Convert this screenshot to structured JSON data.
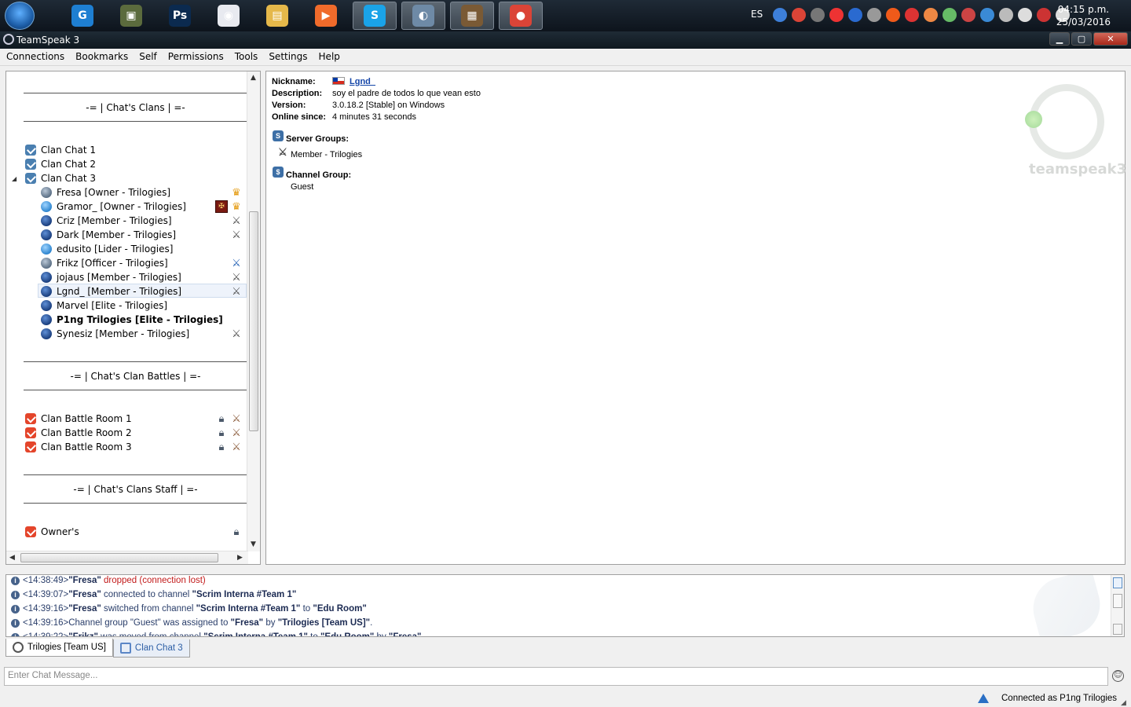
{
  "taskbar": {
    "icons": [
      {
        "name": "teamviewer-like-icon",
        "glyph": "G",
        "color": "#1e7fd2"
      },
      {
        "name": "terminal-icon",
        "glyph": "▣",
        "color": "#5b6b3d"
      },
      {
        "name": "photoshop-icon",
        "glyph": "Ps",
        "color": "#0b2a4f"
      },
      {
        "name": "target-app-icon",
        "glyph": "◉",
        "color": "#e8eaf0"
      },
      {
        "name": "folder-icon",
        "glyph": "▤",
        "color": "#e5b84a"
      },
      {
        "name": "media-player-icon",
        "glyph": "▶",
        "color": "#f06b2b"
      },
      {
        "name": "skype-icon",
        "glyph": "S",
        "color": "#1aa3e8"
      },
      {
        "name": "teamspeak-icon",
        "glyph": "◐",
        "color": "#6e8aa6"
      },
      {
        "name": "minecraft-icon",
        "glyph": "▦",
        "color": "#7a5a35"
      },
      {
        "name": "chrome-icon",
        "glyph": "●",
        "color": "#db4437"
      }
    ],
    "language": "ES",
    "time": "04:15 p.m.",
    "date": "25/03/2016"
  },
  "window": {
    "title": "TeamSpeak 3",
    "min_label": "▁",
    "max_label": "▢",
    "close_label": "✕"
  },
  "menu": [
    "Connections",
    "Bookmarks",
    "Self",
    "Permissions",
    "Tools",
    "Settings",
    "Help"
  ],
  "tree": {
    "spacer_clans": "-= | Chat's Clans | =-",
    "spacer_battles": "-= | Chat's Clan Battles | =-",
    "spacer_staff": "-= | Chat's Clans Staff | =-",
    "channels_top": [
      "Clan Chat 1",
      "Clan Chat 2",
      "Clan Chat 3"
    ],
    "users": [
      {
        "name": "Fresa [Owner - Trilogies]",
        "status": "mute"
      },
      {
        "name": "Gramor_ [Owner - Trilogies]",
        "status": "light"
      },
      {
        "name": "Criz [Member  - Trilogies]",
        "status": "dark"
      },
      {
        "name": "Dark [Member  - Trilogies]",
        "status": "dark"
      },
      {
        "name": "edusito [Lider  - Trilogies]",
        "status": "light"
      },
      {
        "name": "Frikz [Officer  - Trilogies]",
        "status": "mute"
      },
      {
        "name": "jojaus [Member  - Trilogies]",
        "status": "dark"
      },
      {
        "name": "Lgnd_ [Member  - Trilogies]",
        "status": "dark"
      },
      {
        "name": "Marvel [Elite  - Trilogies]",
        "status": "dark"
      },
      {
        "name": "P1ng Trilogies [Elite  - Trilogies]",
        "status": "dark"
      },
      {
        "name": "Synesiz [Member  - Trilogies]",
        "status": "dark"
      }
    ],
    "battle_rooms": [
      "Clan Battle Room 1",
      "Clan Battle Room 2",
      "Clan Battle Room 3"
    ],
    "staff_rooms": [
      "Owner's"
    ]
  },
  "info": {
    "nickname_label": "Nickname:",
    "nickname": "Lgnd_",
    "description_label": "Description:",
    "description": "soy el padre de todos lo que vean esto",
    "version_label": "Version:",
    "version": "3.0.18.2 [Stable] on Windows",
    "online_label": "Online since:",
    "online": "4 minutes 31 seconds",
    "server_groups_label": "Server Groups:",
    "server_group": "Member  - Trilogies",
    "channel_group_label": "Channel Group:",
    "channel_group": "Guest",
    "watermark": "teamspeak3"
  },
  "log": [
    {
      "time": "<14:38:49>",
      "parts": [
        {
          "t": "\"Fresa\"",
          "k": "name"
        },
        {
          "t": " dropped (connection lost)",
          "k": "red"
        }
      ]
    },
    {
      "time": "<14:39:07>",
      "parts": [
        {
          "t": "\"Fresa\"",
          "k": "name"
        },
        {
          "t": " connected to channel ",
          "k": "text"
        },
        {
          "t": "\"Scrim Interna #Team 1\"",
          "k": "name"
        }
      ]
    },
    {
      "time": "<14:39:16>",
      "parts": [
        {
          "t": "\"Fresa\"",
          "k": "name"
        },
        {
          "t": " switched from channel ",
          "k": "text"
        },
        {
          "t": "\"Scrim Interna #Team 1\"",
          "k": "name"
        },
        {
          "t": " to ",
          "k": "text"
        },
        {
          "t": "\"Edu Room\"",
          "k": "name"
        }
      ]
    },
    {
      "time": "<14:39:16>",
      "parts": [
        {
          "t": "Channel group \"Guest\" was assigned to ",
          "k": "text"
        },
        {
          "t": "\"Fresa\"",
          "k": "name"
        },
        {
          "t": " by ",
          "k": "text"
        },
        {
          "t": "\"Trilogies [Team US]\"",
          "k": "name"
        },
        {
          "t": ".",
          "k": "text"
        }
      ]
    },
    {
      "time": "<14:39:22>",
      "parts": [
        {
          "t": "\"Frikz\"",
          "k": "name"
        },
        {
          "t": " was moved from channel ",
          "k": "text"
        },
        {
          "t": "\"Scrim Interna #Team 1\"",
          "k": "name"
        },
        {
          "t": " to ",
          "k": "text"
        },
        {
          "t": "\"Edu Room\"",
          "k": "name"
        },
        {
          "t": " by ",
          "k": "text"
        },
        {
          "t": "\"Fresa\"",
          "k": "name"
        }
      ]
    }
  ],
  "tabs": [
    "Trilogies [Team US]",
    "Clan Chat 3"
  ],
  "chat": {
    "placeholder": "Enter Chat Message..."
  },
  "status": {
    "text": "Connected as P1ng Trilogies"
  },
  "colors": {
    "accent": "#1546a8",
    "log_red": "#c21a1a",
    "channel_red": "#e4452b"
  }
}
